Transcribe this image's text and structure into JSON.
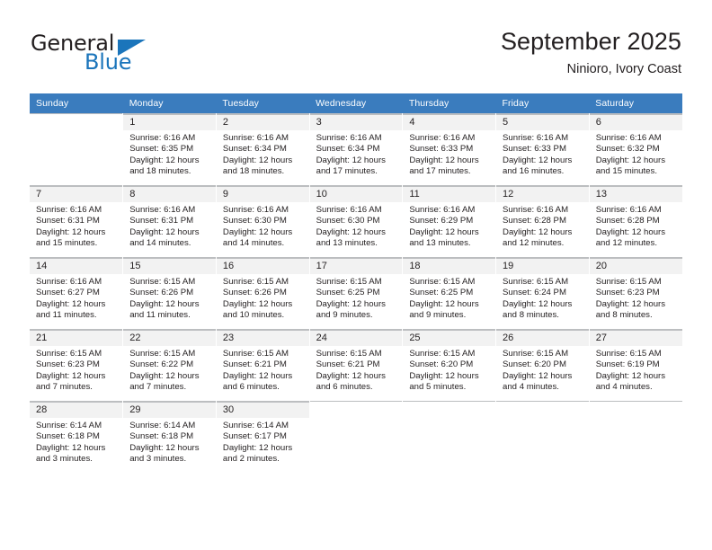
{
  "logo": {
    "word_primary": "General",
    "word_secondary": "Blue",
    "triangle_icon": "triangle-icon"
  },
  "header": {
    "title": "September 2025",
    "subtitle": "Ninioro, Ivory Coast"
  },
  "colors": {
    "header_band": "#3a7cbe",
    "daynum_band": "#f2f2f2",
    "brand_blue": "#1b75bb",
    "text": "#231f20",
    "grid_line": "#bcbec0"
  },
  "weekday_headers": [
    "Sunday",
    "Monday",
    "Tuesday",
    "Wednesday",
    "Thursday",
    "Friday",
    "Saturday"
  ],
  "weeks": [
    [
      {
        "day": "",
        "sunrise": "",
        "sunset": "",
        "daylight": "",
        "blank": true
      },
      {
        "day": "1",
        "sunrise": "Sunrise: 6:16 AM",
        "sunset": "Sunset: 6:35 PM",
        "daylight": "Daylight: 12 hours and 18 minutes."
      },
      {
        "day": "2",
        "sunrise": "Sunrise: 6:16 AM",
        "sunset": "Sunset: 6:34 PM",
        "daylight": "Daylight: 12 hours and 18 minutes."
      },
      {
        "day": "3",
        "sunrise": "Sunrise: 6:16 AM",
        "sunset": "Sunset: 6:34 PM",
        "daylight": "Daylight: 12 hours and 17 minutes."
      },
      {
        "day": "4",
        "sunrise": "Sunrise: 6:16 AM",
        "sunset": "Sunset: 6:33 PM",
        "daylight": "Daylight: 12 hours and 17 minutes."
      },
      {
        "day": "5",
        "sunrise": "Sunrise: 6:16 AM",
        "sunset": "Sunset: 6:33 PM",
        "daylight": "Daylight: 12 hours and 16 minutes."
      },
      {
        "day": "6",
        "sunrise": "Sunrise: 6:16 AM",
        "sunset": "Sunset: 6:32 PM",
        "daylight": "Daylight: 12 hours and 15 minutes."
      }
    ],
    [
      {
        "day": "7",
        "sunrise": "Sunrise: 6:16 AM",
        "sunset": "Sunset: 6:31 PM",
        "daylight": "Daylight: 12 hours and 15 minutes."
      },
      {
        "day": "8",
        "sunrise": "Sunrise: 6:16 AM",
        "sunset": "Sunset: 6:31 PM",
        "daylight": "Daylight: 12 hours and 14 minutes."
      },
      {
        "day": "9",
        "sunrise": "Sunrise: 6:16 AM",
        "sunset": "Sunset: 6:30 PM",
        "daylight": "Daylight: 12 hours and 14 minutes."
      },
      {
        "day": "10",
        "sunrise": "Sunrise: 6:16 AM",
        "sunset": "Sunset: 6:30 PM",
        "daylight": "Daylight: 12 hours and 13 minutes."
      },
      {
        "day": "11",
        "sunrise": "Sunrise: 6:16 AM",
        "sunset": "Sunset: 6:29 PM",
        "daylight": "Daylight: 12 hours and 13 minutes."
      },
      {
        "day": "12",
        "sunrise": "Sunrise: 6:16 AM",
        "sunset": "Sunset: 6:28 PM",
        "daylight": "Daylight: 12 hours and 12 minutes."
      },
      {
        "day": "13",
        "sunrise": "Sunrise: 6:16 AM",
        "sunset": "Sunset: 6:28 PM",
        "daylight": "Daylight: 12 hours and 12 minutes."
      }
    ],
    [
      {
        "day": "14",
        "sunrise": "Sunrise: 6:16 AM",
        "sunset": "Sunset: 6:27 PM",
        "daylight": "Daylight: 12 hours and 11 minutes."
      },
      {
        "day": "15",
        "sunrise": "Sunrise: 6:15 AM",
        "sunset": "Sunset: 6:26 PM",
        "daylight": "Daylight: 12 hours and 11 minutes."
      },
      {
        "day": "16",
        "sunrise": "Sunrise: 6:15 AM",
        "sunset": "Sunset: 6:26 PM",
        "daylight": "Daylight: 12 hours and 10 minutes."
      },
      {
        "day": "17",
        "sunrise": "Sunrise: 6:15 AM",
        "sunset": "Sunset: 6:25 PM",
        "daylight": "Daylight: 12 hours and 9 minutes."
      },
      {
        "day": "18",
        "sunrise": "Sunrise: 6:15 AM",
        "sunset": "Sunset: 6:25 PM",
        "daylight": "Daylight: 12 hours and 9 minutes."
      },
      {
        "day": "19",
        "sunrise": "Sunrise: 6:15 AM",
        "sunset": "Sunset: 6:24 PM",
        "daylight": "Daylight: 12 hours and 8 minutes."
      },
      {
        "day": "20",
        "sunrise": "Sunrise: 6:15 AM",
        "sunset": "Sunset: 6:23 PM",
        "daylight": "Daylight: 12 hours and 8 minutes."
      }
    ],
    [
      {
        "day": "21",
        "sunrise": "Sunrise: 6:15 AM",
        "sunset": "Sunset: 6:23 PM",
        "daylight": "Daylight: 12 hours and 7 minutes."
      },
      {
        "day": "22",
        "sunrise": "Sunrise: 6:15 AM",
        "sunset": "Sunset: 6:22 PM",
        "daylight": "Daylight: 12 hours and 7 minutes."
      },
      {
        "day": "23",
        "sunrise": "Sunrise: 6:15 AM",
        "sunset": "Sunset: 6:21 PM",
        "daylight": "Daylight: 12 hours and 6 minutes."
      },
      {
        "day": "24",
        "sunrise": "Sunrise: 6:15 AM",
        "sunset": "Sunset: 6:21 PM",
        "daylight": "Daylight: 12 hours and 6 minutes."
      },
      {
        "day": "25",
        "sunrise": "Sunrise: 6:15 AM",
        "sunset": "Sunset: 6:20 PM",
        "daylight": "Daylight: 12 hours and 5 minutes."
      },
      {
        "day": "26",
        "sunrise": "Sunrise: 6:15 AM",
        "sunset": "Sunset: 6:20 PM",
        "daylight": "Daylight: 12 hours and 4 minutes."
      },
      {
        "day": "27",
        "sunrise": "Sunrise: 6:15 AM",
        "sunset": "Sunset: 6:19 PM",
        "daylight": "Daylight: 12 hours and 4 minutes."
      }
    ],
    [
      {
        "day": "28",
        "sunrise": "Sunrise: 6:14 AM",
        "sunset": "Sunset: 6:18 PM",
        "daylight": "Daylight: 12 hours and 3 minutes."
      },
      {
        "day": "29",
        "sunrise": "Sunrise: 6:14 AM",
        "sunset": "Sunset: 6:18 PM",
        "daylight": "Daylight: 12 hours and 3 minutes."
      },
      {
        "day": "30",
        "sunrise": "Sunrise: 6:14 AM",
        "sunset": "Sunset: 6:17 PM",
        "daylight": "Daylight: 12 hours and 2 minutes."
      },
      {
        "day": "",
        "sunrise": "",
        "sunset": "",
        "daylight": "",
        "blank": true
      },
      {
        "day": "",
        "sunrise": "",
        "sunset": "",
        "daylight": "",
        "blank": true
      },
      {
        "day": "",
        "sunrise": "",
        "sunset": "",
        "daylight": "",
        "blank": true
      },
      {
        "day": "",
        "sunrise": "",
        "sunset": "",
        "daylight": "",
        "blank": true
      }
    ]
  ]
}
